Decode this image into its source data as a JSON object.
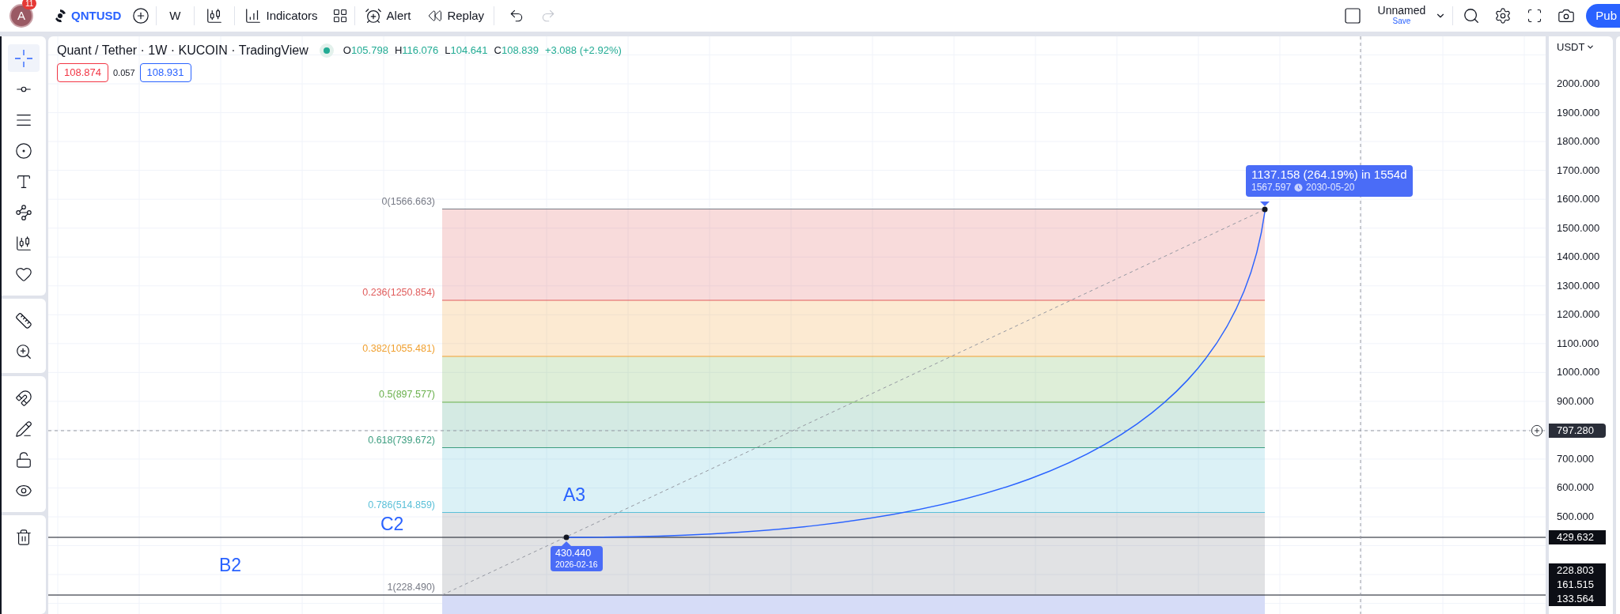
{
  "top_bar": {
    "avatar_initial": "A",
    "notification_count": "11",
    "symbol": "QNTUSD",
    "interval": "W",
    "indicators": "Indicators",
    "alert": "Alert",
    "replay": "Replay",
    "undo": {
      "disabled": false
    },
    "redo": {
      "disabled": true
    },
    "layout_name": "Unnamed",
    "layout_status": "Save",
    "publish": "Pub"
  },
  "left_toolbar": {
    "groups": [
      {
        "tools": [
          {
            "kind": "crosshair",
            "selected": true
          },
          {
            "kind": "line",
            "selected": false
          },
          {
            "kind": "parallel-lines",
            "selected": false
          },
          {
            "kind": "circle",
            "selected": false
          },
          {
            "kind": "text",
            "selected": false
          },
          {
            "kind": "pattern",
            "selected": false
          },
          {
            "kind": "candles",
            "selected": false
          },
          {
            "kind": "heart",
            "selected": false
          }
        ]
      },
      {
        "tools": [
          {
            "kind": "ruler",
            "selected": false
          },
          {
            "kind": "zoom",
            "selected": false
          }
        ]
      },
      {
        "tools": [
          {
            "kind": "magnet",
            "selected": false
          },
          {
            "kind": "pencil-lock",
            "selected": false
          },
          {
            "kind": "lock",
            "selected": false
          },
          {
            "kind": "eye",
            "selected": false
          }
        ]
      },
      {
        "tools": [
          {
            "kind": "trash",
            "selected": false
          }
        ]
      }
    ]
  },
  "chart": {
    "legend": {
      "title": "Quant / Tether · 1W · KUCOIN · TradingView",
      "ohlc": [
        {
          "key": "O",
          "value": "105.798"
        },
        {
          "key": "H",
          "value": "116.076"
        },
        {
          "key": "L",
          "value": "104.641"
        },
        {
          "key": "C",
          "value": "108.839"
        }
      ],
      "change": "+3.088 (+2.92%)",
      "bid": "108.874",
      "spread": "0.057",
      "ask": "108.931"
    },
    "fib_levels": [
      {
        "label": "0(1566.663)",
        "color": "#787b86"
      },
      {
        "label": "0.236(1250.854)",
        "color": "#e05c5c"
      },
      {
        "label": "0.382(1055.481)",
        "color": "#f0a030"
      },
      {
        "label": "0.5(897.577)",
        "color": "#6ab04c"
      },
      {
        "label": "0.618(739.672)",
        "color": "#3d9e80"
      },
      {
        "label": "0.786(514.859)",
        "color": "#5bc0d8"
      },
      {
        "label": "1(228.490)",
        "color": "#787b86"
      }
    ],
    "labels": [
      {
        "text": "A3"
      },
      {
        "text": "C2"
      },
      {
        "text": "B2"
      }
    ],
    "start_tooltip": {
      "price": "430.440",
      "date": "2026-02-16"
    },
    "end_tooltip": {
      "change": "1137.158 (264.19%) in 1554d",
      "price": "1567.597",
      "date": "2030-05-20"
    }
  },
  "price_axis": {
    "currency": "USDT",
    "ticks": [
      "2000.000",
      "1900.000",
      "1800.000",
      "1700.000",
      "1600.000",
      "1500.000",
      "1400.000",
      "1300.000",
      "1200.000",
      "1100.000",
      "1000.000",
      "900.000",
      "700.000",
      "600.000",
      "500.000"
    ],
    "badges": [
      {
        "text": "797.280",
        "kind": "crosshair"
      },
      {
        "text": "429.632",
        "kind": "line"
      },
      {
        "text": "228.803",
        "kind": "line"
      },
      {
        "text": "161.515",
        "kind": "line"
      },
      {
        "text": "133.564",
        "kind": "line"
      }
    ]
  }
}
